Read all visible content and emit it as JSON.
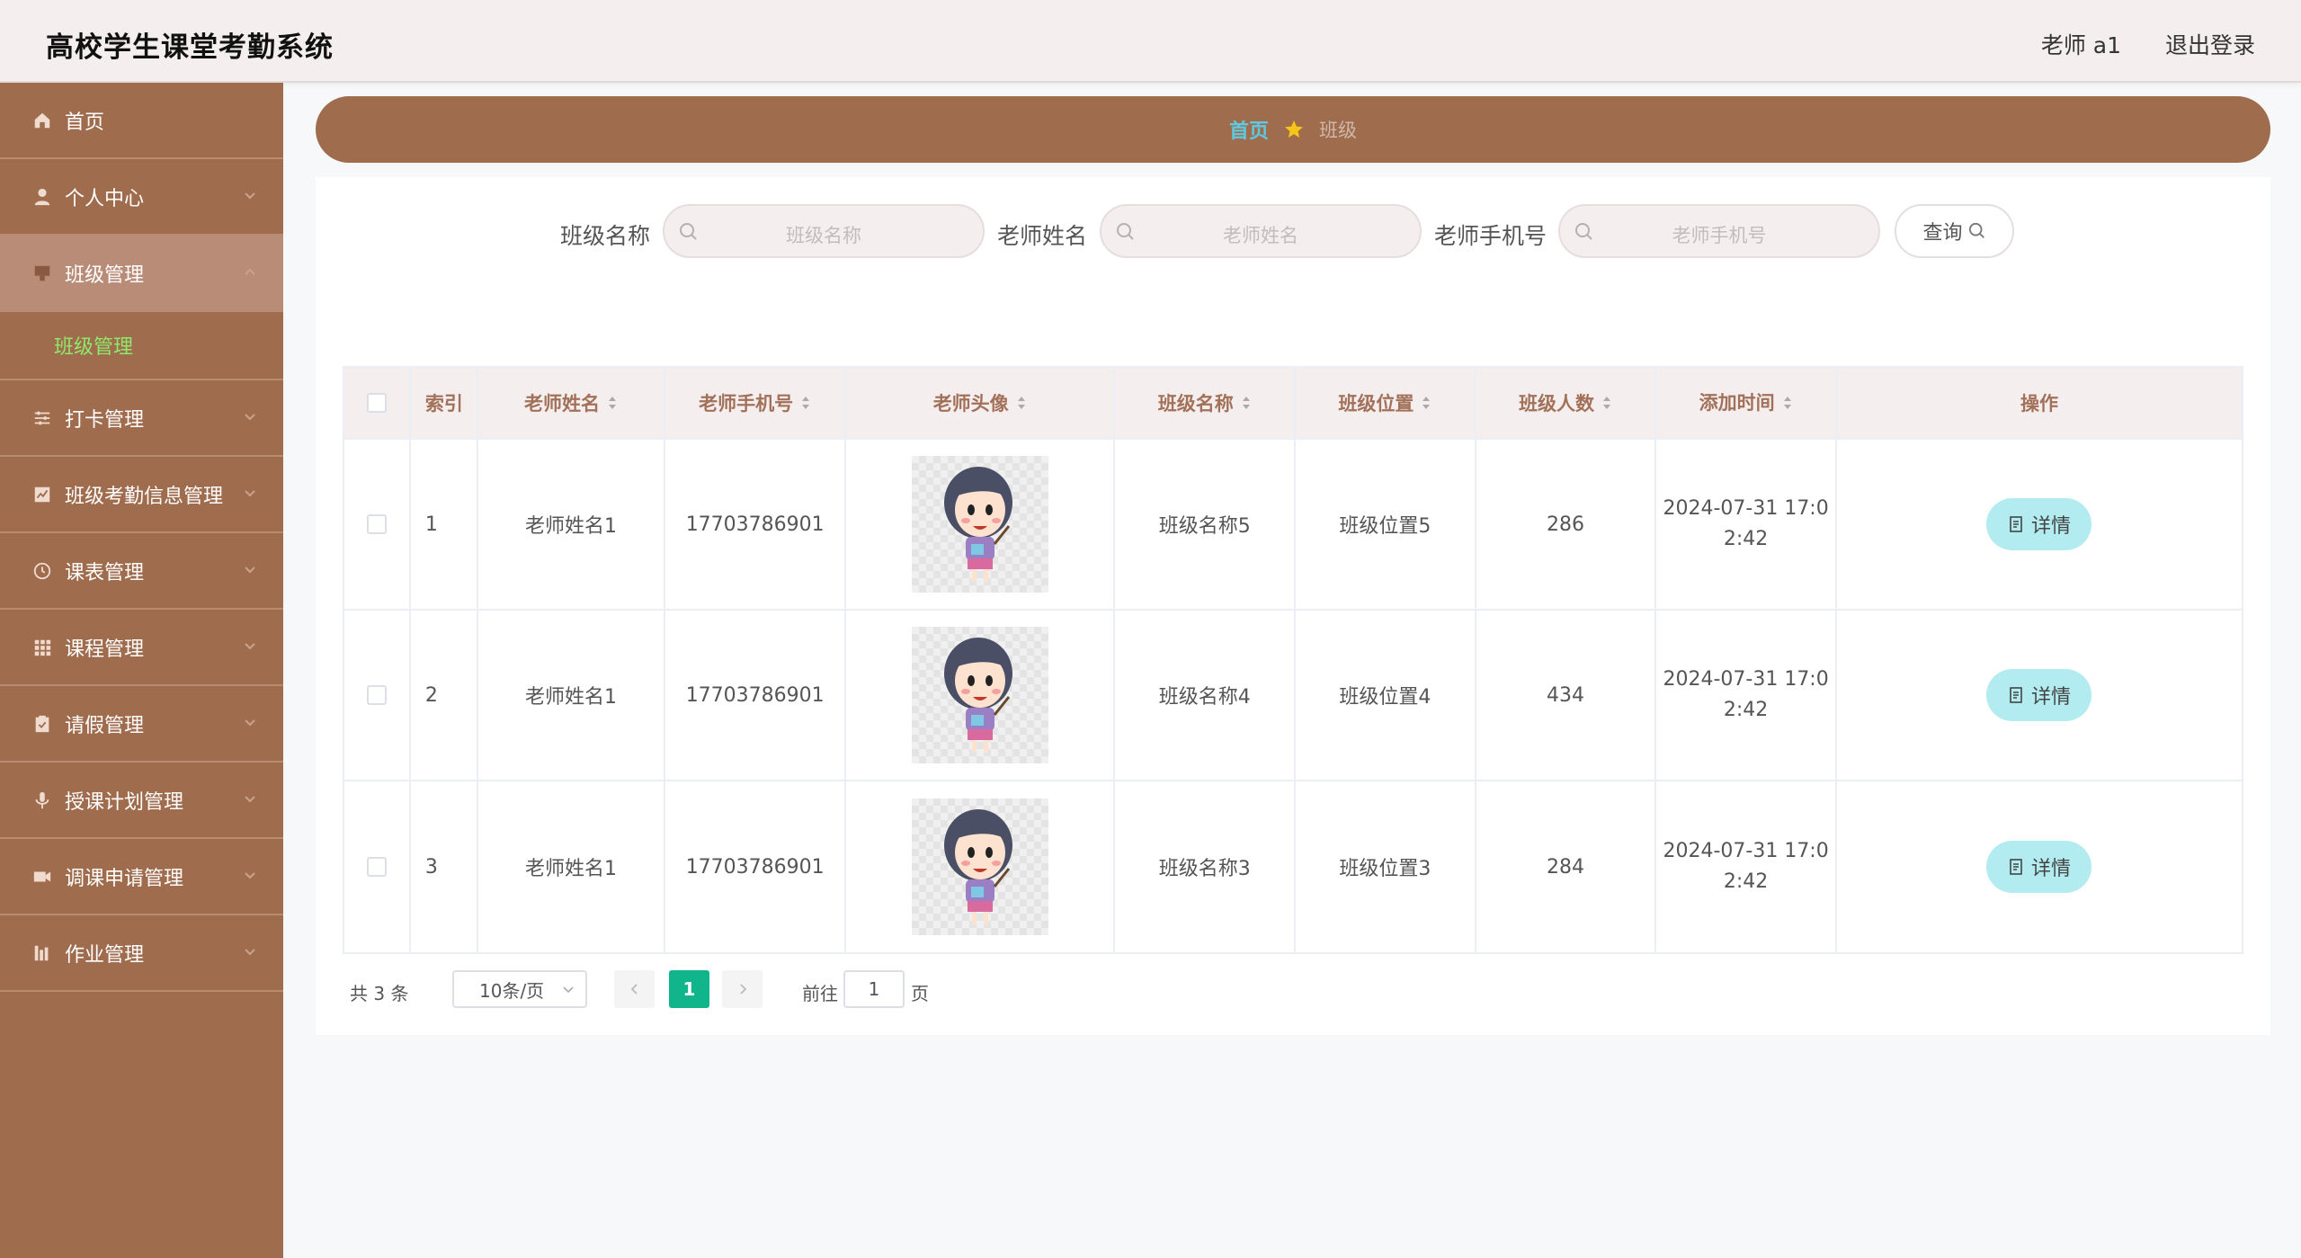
{
  "app": {
    "title": "高校学生课堂考勤系统",
    "user": "老师 a1",
    "logout": "退出登录"
  },
  "sidebar": {
    "items": [
      {
        "label": "首页",
        "icon": "home-icon"
      },
      {
        "label": "个人中心",
        "icon": "user-icon"
      },
      {
        "label": "班级管理",
        "icon": "class-icon"
      },
      {
        "label": "打卡管理",
        "icon": "sliders-icon"
      },
      {
        "label": "班级考勤信息管理",
        "icon": "chart-icon"
      },
      {
        "label": "课表管理",
        "icon": "clock-icon"
      },
      {
        "label": "课程管理",
        "icon": "grid-icon"
      },
      {
        "label": "请假管理",
        "icon": "clipboard-icon"
      },
      {
        "label": "授课计划管理",
        "icon": "mic-icon"
      },
      {
        "label": "调课申请管理",
        "icon": "video-icon"
      },
      {
        "label": "作业管理",
        "icon": "bars-icon"
      }
    ],
    "submenu": {
      "label": "班级管理"
    }
  },
  "breadcrumb": {
    "home": "首页",
    "current": "班级"
  },
  "search": {
    "class_label": "班级名称",
    "class_placeholder": "班级名称",
    "teacher_label": "老师姓名",
    "teacher_placeholder": "老师姓名",
    "phone_label": "老师手机号",
    "phone_placeholder": "老师手机号",
    "query": "查询"
  },
  "table": {
    "headers": {
      "index": "索引",
      "name": "老师姓名",
      "phone": "老师手机号",
      "avatar": "老师头像",
      "cls": "班级名称",
      "pos": "班级位置",
      "cnt": "班级人数",
      "time": "添加时间",
      "op": "操作"
    },
    "rows": [
      {
        "index": "1",
        "name": "老师姓名1",
        "phone": "17703786901",
        "cls": "班级名称5",
        "pos": "班级位置5",
        "cnt": "286",
        "time": "2024-07-31 17:0\n2:42",
        "op": "详情"
      },
      {
        "index": "2",
        "name": "老师姓名1",
        "phone": "17703786901",
        "cls": "班级名称4",
        "pos": "班级位置4",
        "cnt": "434",
        "time": "2024-07-31 17:0\n2:42",
        "op": "详情"
      },
      {
        "index": "3",
        "name": "老师姓名1",
        "phone": "17703786901",
        "cls": "班级名称3",
        "pos": "班级位置3",
        "cnt": "284",
        "time": "2024-07-31 17:0\n2:42",
        "op": "详情"
      }
    ]
  },
  "pager": {
    "total": "共 3 条",
    "size": "10条/页",
    "current": "1",
    "goto": "前往",
    "goto_value": "1",
    "page_suffix": "页"
  },
  "colors": {
    "brown": "#a06c4e",
    "accent_green": "#11b58c",
    "detail_btn": "#b3ecf0",
    "crumb_home": "#5ec9e0"
  }
}
